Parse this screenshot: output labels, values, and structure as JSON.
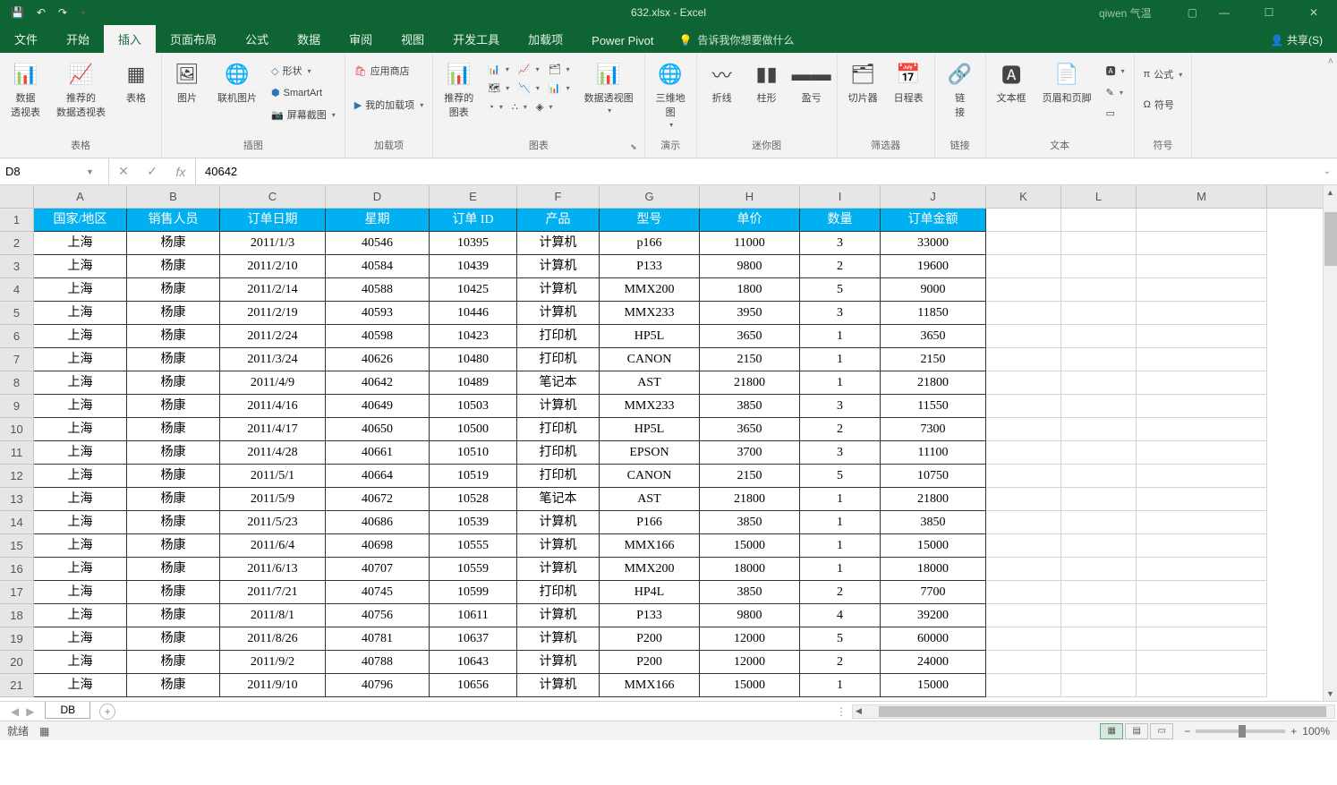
{
  "title": "632.xlsx - Excel",
  "user": "qiwen 气温",
  "share": "共享(S)",
  "tabs": [
    "文件",
    "开始",
    "插入",
    "页面布局",
    "公式",
    "数据",
    "审阅",
    "视图",
    "开发工具",
    "加载项",
    "Power Pivot"
  ],
  "active_tab": "插入",
  "tellme": "告诉我你想要做什么",
  "ribbon_groups": {
    "tables": {
      "label": "表格",
      "pivot": "数据\n透视表",
      "rec_pivot": "推荐的\n数据透视表",
      "table": "表格"
    },
    "illust": {
      "label": "插图",
      "pic": "图片",
      "online_pic": "联机图片",
      "shapes": "形状",
      "smartart": "SmartArt",
      "screenshot": "屏幕截图"
    },
    "addins": {
      "label": "加载项",
      "store": "应用商店",
      "myaddins": "我的加载项"
    },
    "charts": {
      "label": "图表",
      "rec": "推荐的\n图表",
      "pivotchart": "数据透视图"
    },
    "tour": {
      "label": "演示",
      "map3d": "三维地\n图"
    },
    "spark": {
      "label": "迷你图",
      "line": "折线",
      "col": "柱形",
      "winloss": "盈亏"
    },
    "filter": {
      "label": "筛选器",
      "slicer": "切片器",
      "timeline": "日程表"
    },
    "links": {
      "label": "链接",
      "link": "链\n接"
    },
    "text": {
      "label": "文本",
      "textbox": "文本框",
      "header": "页眉和页脚"
    },
    "symbols": {
      "label": "符号",
      "eq": "公式",
      "sym": "符号"
    }
  },
  "name_box": "D8",
  "formula": "40642",
  "columns": [
    "A",
    "B",
    "C",
    "D",
    "E",
    "F",
    "G",
    "H",
    "I",
    "J",
    "K",
    "L",
    "M"
  ],
  "col_widths": [
    "wA",
    "wB",
    "wC",
    "wD",
    "wE",
    "wF",
    "wG",
    "wH",
    "wI",
    "wJ",
    "wK",
    "wL",
    "wM"
  ],
  "headers": [
    "国家/地区",
    "销售人员",
    "订单日期",
    "星期",
    "订单 ID",
    "产品",
    "型号",
    "单价",
    "数量",
    "订单金额"
  ],
  "rows": [
    [
      "上海",
      "杨康",
      "2011/1/3",
      "40546",
      "10395",
      "计算机",
      "p166",
      "11000",
      "3",
      "33000"
    ],
    [
      "上海",
      "杨康",
      "2011/2/10",
      "40584",
      "10439",
      "计算机",
      "P133",
      "9800",
      "2",
      "19600"
    ],
    [
      "上海",
      "杨康",
      "2011/2/14",
      "40588",
      "10425",
      "计算机",
      "MMX200",
      "1800",
      "5",
      "9000"
    ],
    [
      "上海",
      "杨康",
      "2011/2/19",
      "40593",
      "10446",
      "计算机",
      "MMX233",
      "3950",
      "3",
      "11850"
    ],
    [
      "上海",
      "杨康",
      "2011/2/24",
      "40598",
      "10423",
      "打印机",
      "HP5L",
      "3650",
      "1",
      "3650"
    ],
    [
      "上海",
      "杨康",
      "2011/3/24",
      "40626",
      "10480",
      "打印机",
      "CANON",
      "2150",
      "1",
      "2150"
    ],
    [
      "上海",
      "杨康",
      "2011/4/9",
      "40642",
      "10489",
      "笔记本",
      "AST",
      "21800",
      "1",
      "21800"
    ],
    [
      "上海",
      "杨康",
      "2011/4/16",
      "40649",
      "10503",
      "计算机",
      "MMX233",
      "3850",
      "3",
      "11550"
    ],
    [
      "上海",
      "杨康",
      "2011/4/17",
      "40650",
      "10500",
      "打印机",
      "HP5L",
      "3650",
      "2",
      "7300"
    ],
    [
      "上海",
      "杨康",
      "2011/4/28",
      "40661",
      "10510",
      "打印机",
      "EPSON",
      "3700",
      "3",
      "11100"
    ],
    [
      "上海",
      "杨康",
      "2011/5/1",
      "40664",
      "10519",
      "打印机",
      "CANON",
      "2150",
      "5",
      "10750"
    ],
    [
      "上海",
      "杨康",
      "2011/5/9",
      "40672",
      "10528",
      "笔记本",
      "AST",
      "21800",
      "1",
      "21800"
    ],
    [
      "上海",
      "杨康",
      "2011/5/23",
      "40686",
      "10539",
      "计算机",
      "P166",
      "3850",
      "1",
      "3850"
    ],
    [
      "上海",
      "杨康",
      "2011/6/4",
      "40698",
      "10555",
      "计算机",
      "MMX166",
      "15000",
      "1",
      "15000"
    ],
    [
      "上海",
      "杨康",
      "2011/6/13",
      "40707",
      "10559",
      "计算机",
      "MMX200",
      "18000",
      "1",
      "18000"
    ],
    [
      "上海",
      "杨康",
      "2011/7/21",
      "40745",
      "10599",
      "打印机",
      "HP4L",
      "3850",
      "2",
      "7700"
    ],
    [
      "上海",
      "杨康",
      "2011/8/1",
      "40756",
      "10611",
      "计算机",
      "P133",
      "9800",
      "4",
      "39200"
    ],
    [
      "上海",
      "杨康",
      "2011/8/26",
      "40781",
      "10637",
      "计算机",
      "P200",
      "12000",
      "5",
      "60000"
    ],
    [
      "上海",
      "杨康",
      "2011/9/2",
      "40788",
      "10643",
      "计算机",
      "P200",
      "12000",
      "2",
      "24000"
    ],
    [
      "上海",
      "杨康",
      "2011/9/10",
      "40796",
      "10656",
      "计算机",
      "MMX166",
      "15000",
      "1",
      "15000"
    ]
  ],
  "sheet_tab": "DB",
  "status": {
    "ready": "就绪",
    "zoom": "100%"
  }
}
